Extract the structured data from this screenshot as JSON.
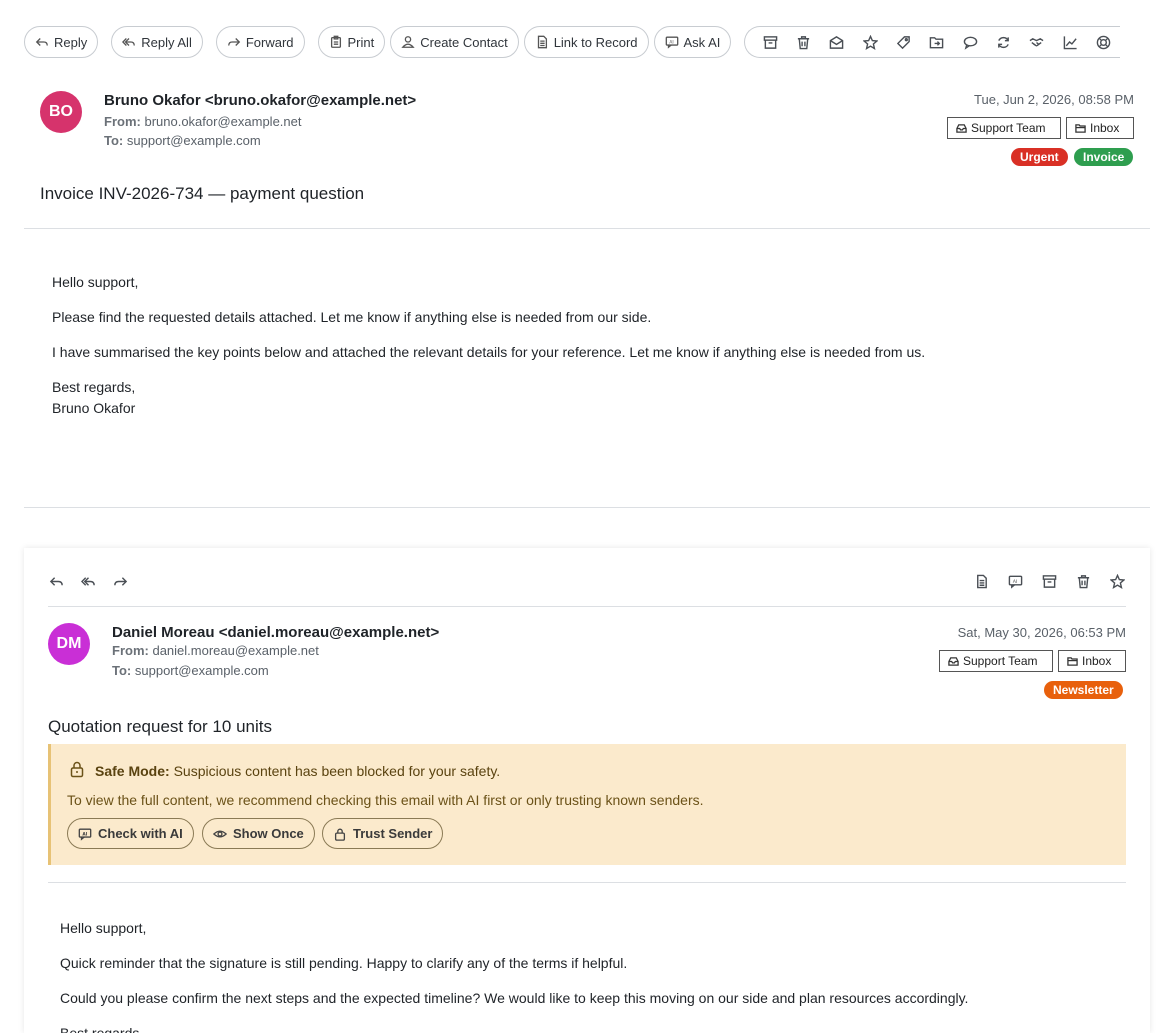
{
  "toolbar": {
    "reply": "Reply",
    "reply_all": "Reply All",
    "forward": "Forward",
    "print": "Print",
    "create_contact": "Create Contact",
    "link_to_record": "Link to Record",
    "ask_ai": "Ask AI",
    "icon_actions": [
      "archive-icon",
      "trash-icon",
      "mark-unread-icon",
      "star-icon",
      "tag-icon",
      "move-folder-icon",
      "chat-icon",
      "refresh-icon",
      "handshake-icon",
      "chart-icon",
      "lifebuoy-icon"
    ]
  },
  "message1": {
    "avatar_initials": "BO",
    "avatar_color": "#d6336c",
    "sender": "Bruno Okafor <bruno.okafor@example.net>",
    "from_label": "From:",
    "from": "bruno.okafor@example.net",
    "to_label": "To:",
    "to": "support@example.com",
    "date": "Tue, Jun 2, 2026, 08:58 PM",
    "folders": [
      "Support Team",
      "Inbox"
    ],
    "tags": [
      {
        "label": "Urgent",
        "color": "#d93025"
      },
      {
        "label": "Invoice",
        "color": "#2e9e4f"
      }
    ],
    "subject": "Invoice INV-2026-734 — payment question",
    "body": {
      "greeting": "Hello support,",
      "p1": "Please find the requested details attached. Let me know if anything else is needed from our side.",
      "p2": "I have summarised the key points below and attached the relevant details for your reference. Let me know if anything else is needed from us.",
      "signoff": "Best regards,",
      "signature": "Bruno Okafor"
    }
  },
  "message2": {
    "avatar_initials": "DM",
    "avatar_color": "#c92fd6",
    "sender": "Daniel Moreau <daniel.moreau@example.net>",
    "from_label": "From:",
    "from": "daniel.moreau@example.net",
    "to_label": "To:",
    "to": "support@example.com",
    "date": "Sat, May 30, 2026, 06:53 PM",
    "folders": [
      "Support Team",
      "Inbox"
    ],
    "tags": [
      {
        "label": "Newsletter",
        "color": "#e8600c"
      }
    ],
    "subject": "Quotation request for 10 units",
    "safe_mode": {
      "title": "Safe Mode:",
      "message": "Suspicious content has been blocked for your safety.",
      "detail": "To view the full content, we recommend checking this email with AI first or only trusting known senders.",
      "check_ai": "Check with AI",
      "show_once": "Show Once",
      "trust_sender": "Trust Sender"
    },
    "body": {
      "greeting": "Hello support,",
      "p1": "Quick reminder that the signature is still pending. Happy to clarify any of the terms if helpful.",
      "p2": "Could you please confirm the next steps and the expected timeline? We would like to keep this moving on our side and plan resources accordingly.",
      "signoff": "Best regards,"
    }
  }
}
